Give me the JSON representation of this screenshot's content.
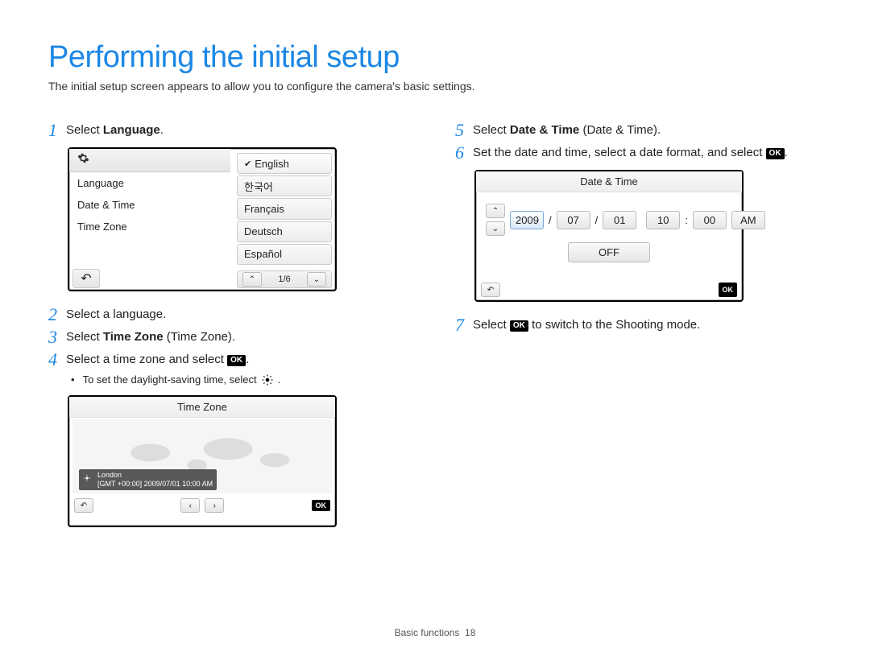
{
  "title": "Performing the initial setup",
  "intro": "The initial setup screen appears to allow you to configure the camera's basic settings.",
  "left": {
    "step1": {
      "n": "1",
      "pre": "Select ",
      "bold": "Language",
      "post": "."
    },
    "langScreen": {
      "menu": [
        "Language",
        "Date & Time",
        "Time Zone"
      ],
      "options": [
        "English",
        "한국어",
        "Français",
        "Deutsch",
        "Español"
      ],
      "pager": "1/6"
    },
    "step2": {
      "n": "2",
      "text": "Select a language."
    },
    "step3": {
      "n": "3",
      "pre": "Select ",
      "bold": "Time Zone",
      "post": " (Time Zone)."
    },
    "step4": {
      "n": "4",
      "pre": "Select a time zone and select ",
      "ok": "OK",
      "post": "."
    },
    "dst": "To set the daylight-saving time, select",
    "tzScreen": {
      "title": "Time Zone",
      "city": "London",
      "info": "[GMT +00:00] 2009/07/01 10:00 AM",
      "ok": "OK"
    }
  },
  "right": {
    "step5": {
      "n": "5",
      "pre": "Select ",
      "bold": "Date & Time",
      "post": " (Date & Time)."
    },
    "step6": {
      "n": "6",
      "pre": "Set the date and time, select a date format, and select ",
      "ok": "OK",
      "post": "."
    },
    "dtScreen": {
      "title": "Date & Time",
      "year": "2009",
      "mon": "07",
      "day": "01",
      "hr": "10",
      "min": "00",
      "ampm": "AM",
      "off": "OFF",
      "ok": "OK"
    },
    "step7": {
      "n": "7",
      "pre": "Select ",
      "ok": "OK",
      "post": " to switch to the Shooting mode."
    }
  },
  "footer": {
    "section": "Basic functions",
    "page": "18"
  }
}
